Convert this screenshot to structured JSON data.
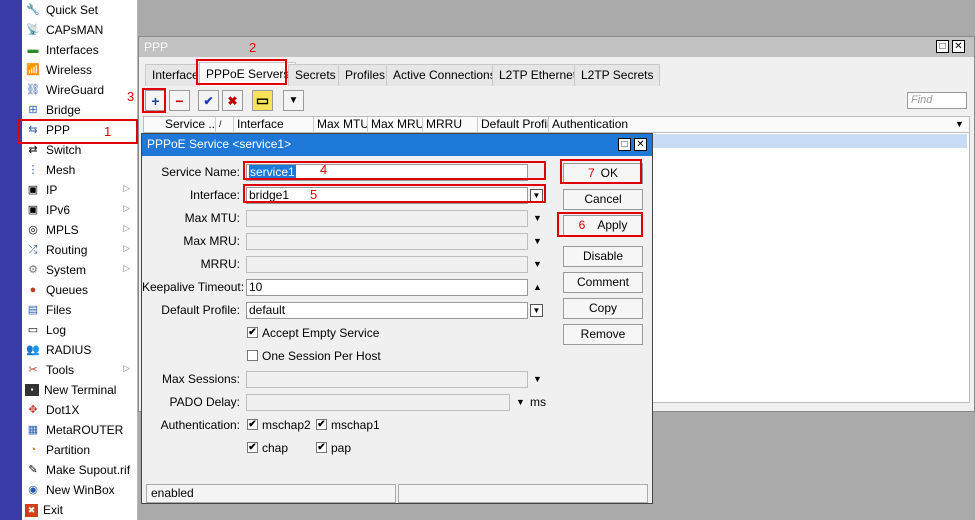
{
  "sidebar": {
    "items": [
      {
        "label": "Quick Set",
        "icon": "quick-set-icon",
        "glyph": "🔧"
      },
      {
        "label": "CAPsMAN",
        "icon": "capsman-icon",
        "glyph": "📡"
      },
      {
        "label": "Interfaces",
        "icon": "interfaces-icon",
        "glyph": "▬"
      },
      {
        "label": "Wireless",
        "icon": "wireless-icon",
        "glyph": "📶"
      },
      {
        "label": "WireGuard",
        "icon": "wireguard-icon",
        "glyph": "⛓"
      },
      {
        "label": "Bridge",
        "icon": "bridge-icon",
        "glyph": "⊞"
      },
      {
        "label": "PPP",
        "icon": "ppp-icon",
        "glyph": "⇆"
      },
      {
        "label": "Switch",
        "icon": "switch-icon",
        "glyph": "⇄"
      },
      {
        "label": "Mesh",
        "icon": "mesh-icon",
        "glyph": "⋮"
      },
      {
        "label": "IP",
        "icon": "ip-icon",
        "glyph": "▣"
      },
      {
        "label": "IPv6",
        "icon": "ipv6-icon",
        "glyph": "▣"
      },
      {
        "label": "MPLS",
        "icon": "mpls-icon",
        "glyph": "◎"
      },
      {
        "label": "Routing",
        "icon": "routing-icon",
        "glyph": "⤮"
      },
      {
        "label": "System",
        "icon": "system-icon",
        "glyph": "⚙"
      },
      {
        "label": "Queues",
        "icon": "queues-icon",
        "glyph": "●"
      },
      {
        "label": "Files",
        "icon": "files-icon",
        "glyph": "▤"
      },
      {
        "label": "Log",
        "icon": "log-icon",
        "glyph": "▭"
      },
      {
        "label": "RADIUS",
        "icon": "radius-icon",
        "glyph": "👥"
      },
      {
        "label": "Tools",
        "icon": "tools-icon",
        "glyph": "✂"
      },
      {
        "label": "New Terminal",
        "icon": "terminal-icon",
        "glyph": "▪"
      },
      {
        "label": "Dot1X",
        "icon": "dot1x-icon",
        "glyph": "✥"
      },
      {
        "label": "MetaROUTER",
        "icon": "metarouter-icon",
        "glyph": "▦"
      },
      {
        "label": "Partition",
        "icon": "partition-icon",
        "glyph": "◔"
      },
      {
        "label": "Make Supout.rif",
        "icon": "supout-icon",
        "glyph": "✎"
      },
      {
        "label": "New WinBox",
        "icon": "winbox-icon",
        "glyph": "◉"
      },
      {
        "label": "Exit",
        "icon": "exit-icon",
        "glyph": "✖"
      }
    ],
    "submenu_arrow": "▷"
  },
  "ppp_window": {
    "title": "PPP",
    "restore_glyph": "□",
    "close_glyph": "✕",
    "tabs": [
      "Interface",
      "PPPoE Servers",
      "Secrets",
      "Profiles",
      "Active Connections",
      "L2TP Ethernet",
      "L2TP Secrets"
    ],
    "toolbar": {
      "add": "+",
      "remove": "−",
      "enable": "✔",
      "disable": "✖",
      "comment": "▭",
      "filter": "▼"
    },
    "find_placeholder": "Find",
    "columns": [
      "Service ...",
      "/",
      "Interface",
      "Max MTU",
      "Max MRU",
      "MRRU",
      "Default Profile",
      "Authentication"
    ],
    "columns_dropdown": "▼"
  },
  "dialog": {
    "title": "PPPoE Service <service1>",
    "fields": {
      "service_name": {
        "label": "Service Name:",
        "value": "service1"
      },
      "interface": {
        "label": "Interface:",
        "value": "bridge1"
      },
      "max_mtu": {
        "label": "Max MTU:",
        "value": ""
      },
      "max_mru": {
        "label": "Max MRU:",
        "value": ""
      },
      "mrru": {
        "label": "MRRU:",
        "value": ""
      },
      "keepalive": {
        "label": "Keepalive Timeout:",
        "value": "10"
      },
      "default_profile": {
        "label": "Default Profile:",
        "value": "default"
      },
      "max_sessions": {
        "label": "Max Sessions:",
        "value": ""
      },
      "pado_delay": {
        "label": "PADO Delay:",
        "value": "",
        "unit": "ms"
      },
      "authentication": {
        "label": "Authentication:"
      }
    },
    "checkboxes": {
      "accept_empty": {
        "label": "Accept Empty Service",
        "checked": true
      },
      "one_session": {
        "label": "One Session Per Host",
        "checked": false
      },
      "mschap2": {
        "label": "mschap2",
        "checked": true
      },
      "mschap1": {
        "label": "mschap1",
        "checked": true
      },
      "chap": {
        "label": "chap",
        "checked": true
      },
      "pap": {
        "label": "pap",
        "checked": true
      }
    },
    "check_glyph": "✔",
    "arrow_down": "▼",
    "arrow_up": "▲",
    "buttons": [
      "OK",
      "Cancel",
      "Apply",
      "Disable",
      "Comment",
      "Copy",
      "Remove"
    ],
    "status_left": "enabled",
    "status_right": ""
  },
  "annotations": [
    "1",
    "2",
    "3",
    "4",
    "5",
    "6",
    "7"
  ],
  "colors": {
    "annotation": "#e00000",
    "title_active": "#1e78d8",
    "sidebar_strip": "#3a3aa8",
    "selection": "#c8dcf5"
  }
}
